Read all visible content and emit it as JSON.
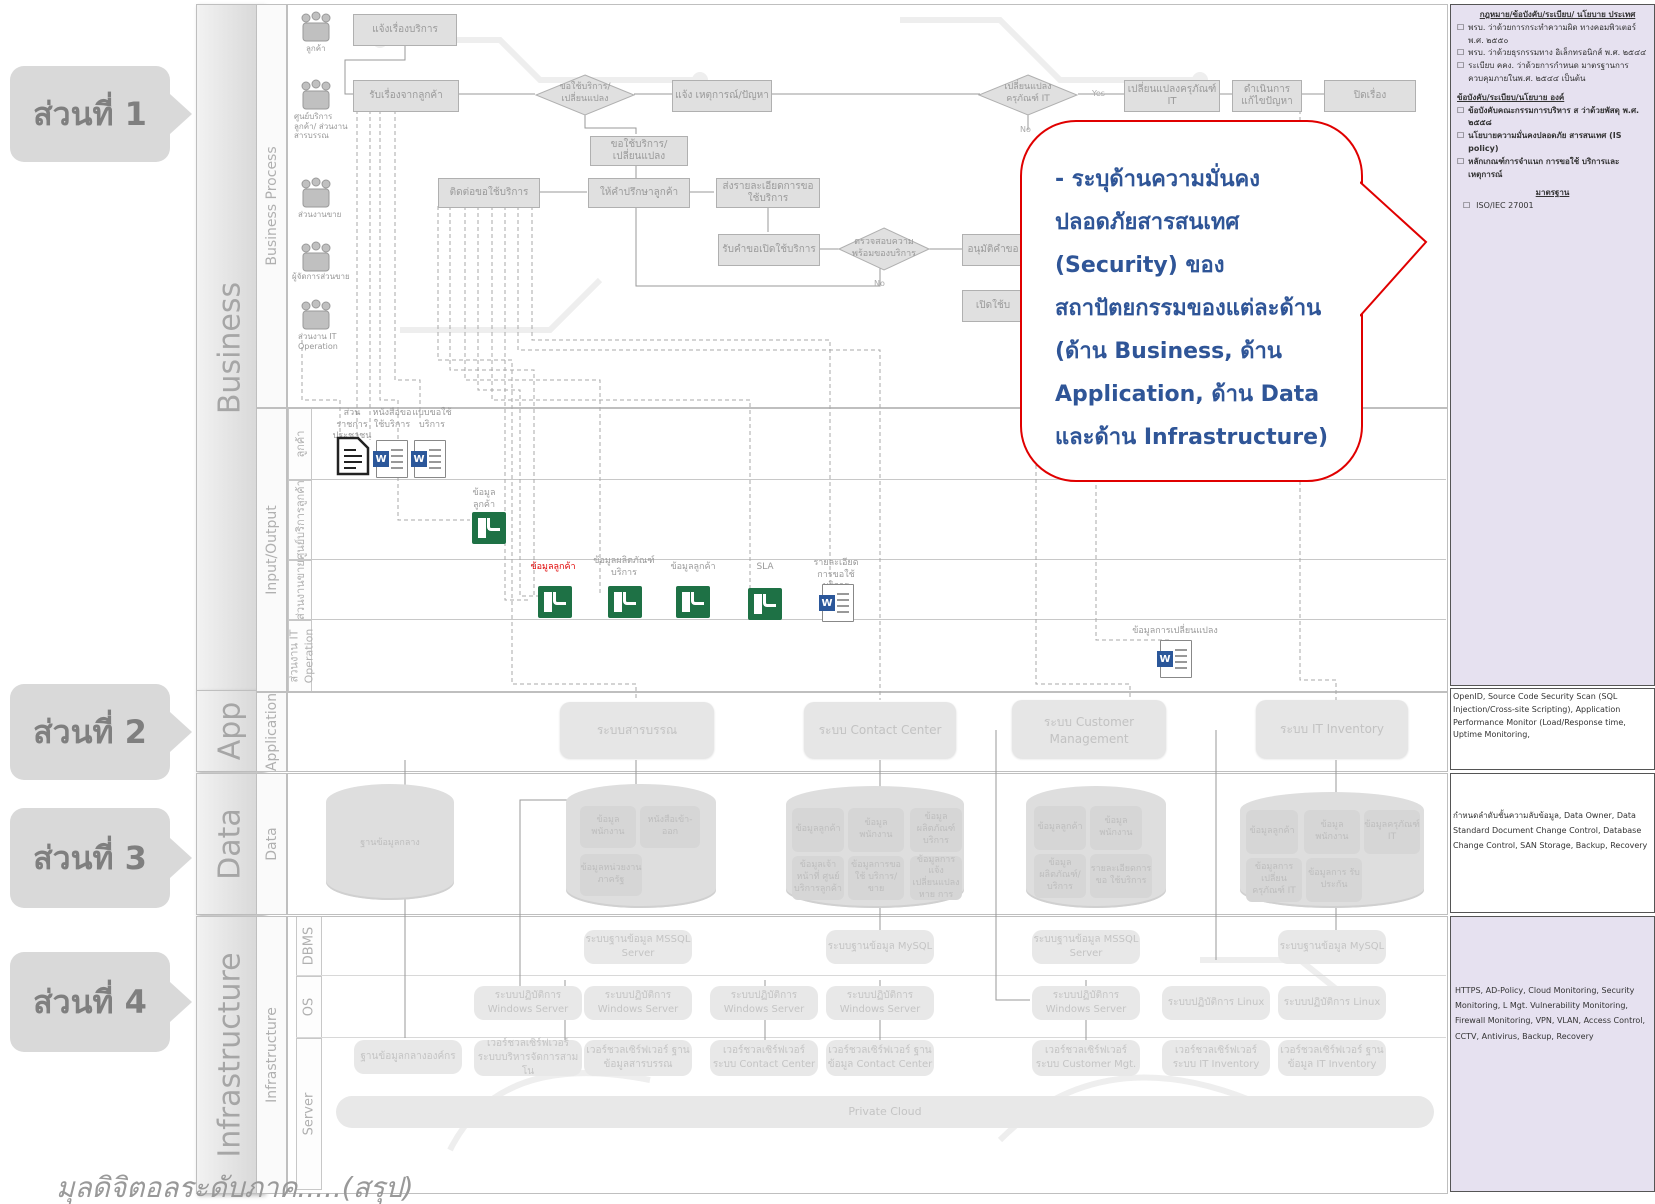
{
  "parts": [
    {
      "label": "ส่วนที่ 1"
    },
    {
      "label": "ส่วนที่ 2"
    },
    {
      "label": "ส่วนที่ 3"
    },
    {
      "label": "ส่วนที่ 4"
    }
  ],
  "layers": {
    "business": "Business",
    "app": "App",
    "data": "Data",
    "infrastructure": "Infrastructure"
  },
  "sublayers": {
    "business_process": "Business Process",
    "input_output": "Input/Output",
    "application": "Application",
    "data": "Data",
    "infrastructure": "Infrastructure"
  },
  "io_rows": [
    "ลูกค้า",
    "ศูนย์บริการลูกค้า",
    "ส่วนงานขาย",
    "ส่วนงาน IT Operation"
  ],
  "infra_rows": [
    "DBMS",
    "OS",
    "Server"
  ],
  "actors": [
    "ลูกค้า",
    "ศูนย์บริการลูกค้า/ ส่วนงานสารบรรณ",
    "ส่วนงานขาย",
    "ผู้จัดการส่วนขาย",
    "ส่วนงาน IT Operation"
  ],
  "process": {
    "notify": "แจ้งเรื่องบริการ",
    "receive": "รับเรื่องจากลูกค้า",
    "decision1": "ขอใช้บริการ/ เปลี่ยนแปลง",
    "report_incident": "แจ้ง เหตุการณ์/ปัญหา",
    "request_change": "ขอใช้บริการ/เปลี่ยนแปลง",
    "contact": "ติดต่อขอใช้บริการ",
    "consult": "ให้คำปรึกษาลูกค้า",
    "send_detail": "ส่งรายละเอียดการขอใช้บริการ",
    "receive_request": "รับคำขอเปิดใช้บริการ",
    "check": "ตรวจสอบความ พร้อมของบริการ",
    "approve": "อนุมัติคำขอ",
    "open": "เปิดใช้บ",
    "decision2": "เปลี่ยนแปลง ครุภัณฑ์ IT",
    "change_it": "เปลี่ยนแปลงครุภัณฑ์ IT",
    "solve": "ดำเนินการแก้ไขปัญหา",
    "close": "ปิดเรื่อง",
    "yes": "Yes",
    "no": "No"
  },
  "documents": {
    "doc1": "ส่วนราชการ ประชาชน",
    "doc2": "หนังสือขอ ใช้บริการ",
    "doc3": "แบบขอใช้ บริการ",
    "cust_center": "ข้อมูลลูกค้า",
    "sales1": "ข้อมูลลูกค้า",
    "sales2": "ข้อมูลผลิตภัณฑ์ บริการ",
    "sales3": "ข้อมูลลูกค้า",
    "sales4": "SLA",
    "sales5": "รายละเอียด การขอใช้บริการ",
    "it_op": "ข้อมูลการเปลี่ยนแปลง"
  },
  "systems": [
    "ระบบสารบรรณ",
    "ระบบ Contact Center",
    "ระบบ Customer Management",
    "ระบบ IT Inventory"
  ],
  "databases": {
    "db1": [
      "ฐานข้อมูลกลาง"
    ],
    "db2": [
      "ข้อมูลพนักงาน",
      "หนังสือเข้า-ออก",
      "ข้อมูลหน่วยงาน ภาครัฐ"
    ],
    "db3": [
      "ข้อมูลลูกค้า",
      "ข้อมูลพนักงาน",
      "ข้อมูลผลิตภัณฑ์ บริการ",
      "ข้อมูลเจ้าหน้าที่ ศูนย์บริการลูกค้า",
      "ข้อมูลการขอใช้ บริการ/ขาย",
      "ข้อมูลการแจ้ง เปลี่ยนแปลงหาย การ"
    ],
    "db4": [
      "ข้อมูลลูกค้า",
      "ข้อมูลพนักงาน",
      "ข้อมูลผลิตภัณฑ์/ บริการ",
      "รายละเอียดการขอ ใช้บริการ"
    ],
    "db5": [
      "ข้อมูลลูกค้า",
      "ข้อมูลพนักงาน",
      "ข้อมูลครุภัณฑ์ IT",
      "ข้อมูลการเปลี่ยน ครุภัณฑ์ IT",
      "ข้อมูลการ รับประกัน"
    ]
  },
  "dbms": [
    "ระบบฐานข้อมูล MSSQL Server",
    "ระบบฐานข้อมูล MySQL",
    "ระบบฐานข้อมูล MSSQL Server",
    "ระบบฐานข้อมูล MySQL"
  ],
  "os": [
    "ระบบปฏิบัติการ Windows Server",
    "ระบบปฏิบัติการ Windows Server",
    "ระบบปฏิบัติการ Windows Server",
    "ระบบปฏิบัติการ Windows Server",
    "ระบบปฏิบัติการ Windows Server",
    "ระบบปฏิบัติการ Linux",
    "ระบบปฏิบัติการ Linux"
  ],
  "servers": [
    "ฐานข้อมูลกลางองค์กร",
    "เวอร์ชวลเซิร์ฟเวอร์ ระบบบริหารจัดการสามโน",
    "เวอร์ชวลเซิร์ฟเวอร์ ฐานข้อมูลสารบรรณ",
    "เวอร์ชวลเซิร์ฟเวอร์ ระบบ Contact Center",
    "เวอร์ชวลเซิร์ฟเวอร์ ฐานข้อมูล Contact Center",
    "เวอร์ชวลเซิร์ฟเวอร์ ระบบ Customer Mgt.",
    "เวอร์ชวลเซิร์ฟเวอร์ ระบบ IT Inventory",
    "เวอร์ชวลเซิร์ฟเวอร์ ฐานข้อมูล IT Inventory"
  ],
  "cloud": "Private Cloud",
  "callout": {
    "lines": [
      "- ระบุด้านความมั่นคง",
      "ปลอดภัยสารสนเทศ",
      "(Security) ของ",
      "สถาปัตยกรรมของแต่ละด้าน",
      "(ด้าน Business, ด้าน",
      "Application, ด้าน Data",
      "และด้าน Infrastructure)"
    ]
  },
  "right_panel": {
    "law_title": "กฎหมาย/ข้อบังคับ/ระเบียบ/ นโยบาย ประเทศ",
    "law_items": [
      "พรบ. ว่าด้วยการกระทำความผิด ทางคอมพิวเตอร์ พ.ศ. ๒๕๕๐",
      "พรบ. ว่าด้วยธุรกรรมทาง อิเล็กทรอนิกส์ พ.ศ. ๒๕๔๔",
      "ระเบียบ คคง. ว่าด้วยการกำหนด มาตรฐานการควบคุมภายในพ.ศ. ๒๕๔๔ เป็นต้น"
    ],
    "org_title": "ข้อบังคับ/ระเบียบ/นโยบาย องค์",
    "org_items": [
      "ข้อบังคับคณะกรรมการบริหาร ส ว่าด้วยพัสดุ พ.ศ. ๒๕๕๘",
      "นโยบายความมั่นคงปลอดภัย สารสนเทศ (IS policy)",
      "หลักเกณฑ์การจำแนก การขอใช้ บริการและเหตุการณ์"
    ],
    "std_title": "มาตรฐาน",
    "std_items": [
      "ISO/IEC 27001"
    ],
    "app_security": "OpenID, Source Code Security Scan (SQL Injection/Cross-site Scripting), Application Performance Monitor (Load/Response time, Uptime Monitoring,",
    "data_security": "กำหนดลำดับชั้นความลับข้อมูล, Data Owner, Data Standard Document Change Control, Database Change Control, SAN Storage, Backup, Recovery",
    "infra_security": "HTTPS, AD-Policy, Cloud Monitoring, Security Monitoring, L Mgt. Vulnerability Monitoring, Firewall Monitoring, VPN, VLAN, Access Control, CCTV, Antivirus, Backup, Recovery"
  },
  "footer_text": "มุลดิจิตอลระดับภาค.....(สรุป)"
}
